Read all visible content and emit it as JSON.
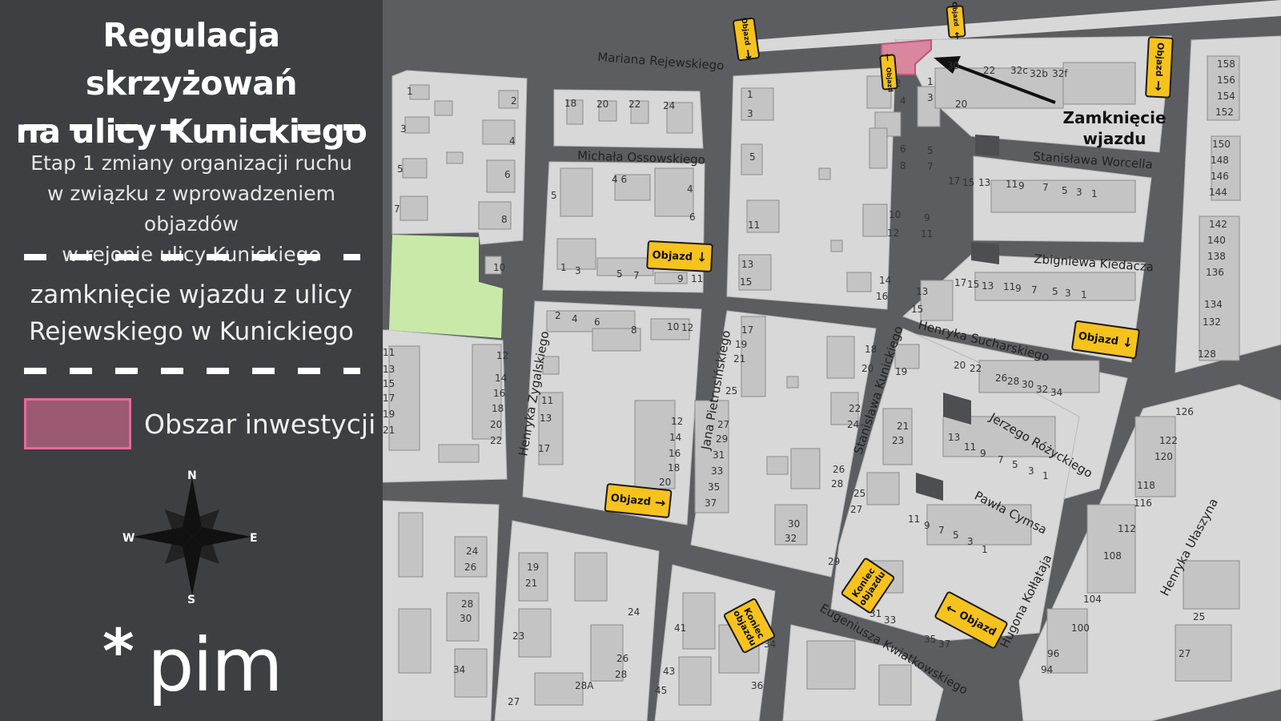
{
  "panel": {
    "title_line1": "Regulacja skrzyżowań",
    "title_line2": "na ulicy Kunickiego",
    "subtitle_line1": "Etap 1 zmiany organizacji ruchu",
    "subtitle_line2": "w związku z wprowadzeniem objazdów",
    "subtitle_line3": "w rejonie ulicy Kunickiego",
    "change_line1": "zamknięcie wjazdu z ulicy",
    "change_line2": "Rejewskiego w Kunickiego",
    "legend_label": "Obszar inwestycji",
    "legend_color": "#9b5a72",
    "compass": {
      "n": "N",
      "e": "E",
      "s": "S",
      "w": "W"
    },
    "logo_star": "*",
    "logo_text": "pim"
  },
  "colors": {
    "panel_bg": "#3d3f43",
    "road": "#5b5d61",
    "block": "#d8d8d8",
    "building": "#c4c4c4",
    "park": "#c9e9a9",
    "sign": "#f6c21d",
    "investment": "#d9869f"
  },
  "map": {
    "closure_label_line1": "Zamknięcie",
    "closure_label_line2": "wjazdu",
    "sign_text": "Objazd",
    "end_sign_line1": "Koniec",
    "end_sign_line2": "objazdu",
    "streets": [
      "Mariana Rejewskiego",
      "Michała Ossowskiego",
      "Stanisława Worcella",
      "Zbigniewa Kiedacza",
      "Henryka Sucharskiego",
      "Jerzego Różyckiego",
      "Pawła Cymsa",
      "Hugona Kołłątaja",
      "Henryka Ułaszyna",
      "Eugeniusza Kwiatkowskiego",
      "Stanisława Kunickiego",
      "Jana Pietrusińskiego",
      "Henryka Zygalskiego"
    ]
  }
}
